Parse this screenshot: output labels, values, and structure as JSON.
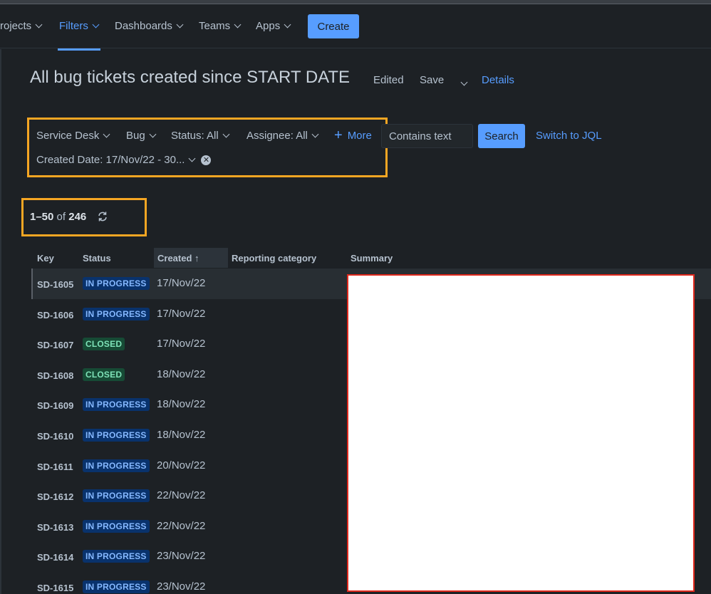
{
  "nav": {
    "items": [
      {
        "label": "rojects",
        "active": false
      },
      {
        "label": "Filters",
        "active": true
      },
      {
        "label": "Dashboards",
        "active": false
      },
      {
        "label": "Teams",
        "active": false
      },
      {
        "label": "Apps",
        "active": false
      }
    ],
    "create_label": "Create"
  },
  "header": {
    "title": "All bug tickets created since START DATE",
    "edited_label": "Edited",
    "save_label": "Save",
    "details_label": "Details"
  },
  "filters": {
    "project": "Service Desk",
    "type": "Bug",
    "status": "Status: All",
    "assignee": "Assignee: All",
    "more": "More",
    "created_date": "Created Date: 17/Nov/22 - 30...",
    "text_placeholder": "Contains text",
    "search_label": "Search",
    "switch_jql_label": "Switch to JQL"
  },
  "results": {
    "range": "1–50",
    "of_label": "of",
    "total": "246"
  },
  "table": {
    "headers": {
      "key": "Key",
      "status": "Status",
      "created": "Created",
      "reporting_category": "Reporting category",
      "summary": "Summary"
    },
    "rows": [
      {
        "key": "SD-1605",
        "status": "IN PROGRESS",
        "created": "17/Nov/22"
      },
      {
        "key": "SD-1606",
        "status": "IN PROGRESS",
        "created": "17/Nov/22"
      },
      {
        "key": "SD-1607",
        "status": "CLOSED",
        "created": "17/Nov/22"
      },
      {
        "key": "SD-1608",
        "status": "CLOSED",
        "created": "18/Nov/22"
      },
      {
        "key": "SD-1609",
        "status": "IN PROGRESS",
        "created": "18/Nov/22"
      },
      {
        "key": "SD-1610",
        "status": "IN PROGRESS",
        "created": "18/Nov/22"
      },
      {
        "key": "SD-1611",
        "status": "IN PROGRESS",
        "created": "20/Nov/22"
      },
      {
        "key": "SD-1612",
        "status": "IN PROGRESS",
        "created": "22/Nov/22"
      },
      {
        "key": "SD-1613",
        "status": "IN PROGRESS",
        "created": "22/Nov/22"
      },
      {
        "key": "SD-1614",
        "status": "IN PROGRESS",
        "created": "23/Nov/22"
      },
      {
        "key": "SD-1615",
        "status": "IN PROGRESS",
        "created": "23/Nov/22"
      }
    ]
  },
  "colors": {
    "accent": "#579dff",
    "highlight_box": "#f5a623",
    "redaction_border": "#e0281c"
  }
}
